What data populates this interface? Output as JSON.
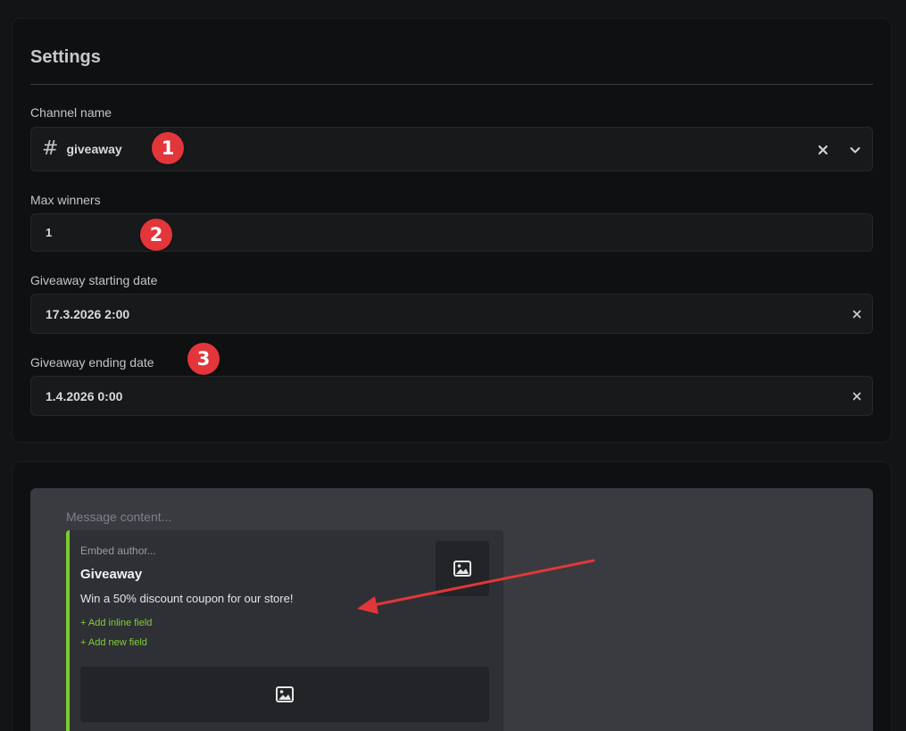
{
  "settings": {
    "title": "Settings",
    "channel": {
      "label": "Channel name",
      "prefix": "#",
      "value": "giveaway"
    },
    "max_winners": {
      "label": "Max winners",
      "value": "1"
    },
    "start_date": {
      "label": "Giveaway starting date",
      "value": "17.3.2026 2:00"
    },
    "end_date": {
      "label": "Giveaway ending date",
      "value": "1.4.2026 0:00"
    }
  },
  "markers": [
    "1",
    "2",
    "3"
  ],
  "message": {
    "placeholder": "Message content...",
    "embed": {
      "author_placeholder": "Embed author...",
      "title": "Giveaway",
      "description": "Win a 50% discount coupon for our store!",
      "add_inline_field": "+ Add inline field",
      "add_new_field": "+ Add new field",
      "accent_color": "#7bce2f"
    }
  },
  "icons": {
    "clear": "close-icon",
    "dropdown": "chevron-down-icon",
    "image": "image-icon",
    "channel": "hash-icon"
  },
  "colors": {
    "background": "#131416",
    "card": "#0f1012",
    "field": "#18191b",
    "marker": "#e2363a",
    "link_green": "#82cc3a",
    "annotation_arrow": "#e2363a"
  }
}
